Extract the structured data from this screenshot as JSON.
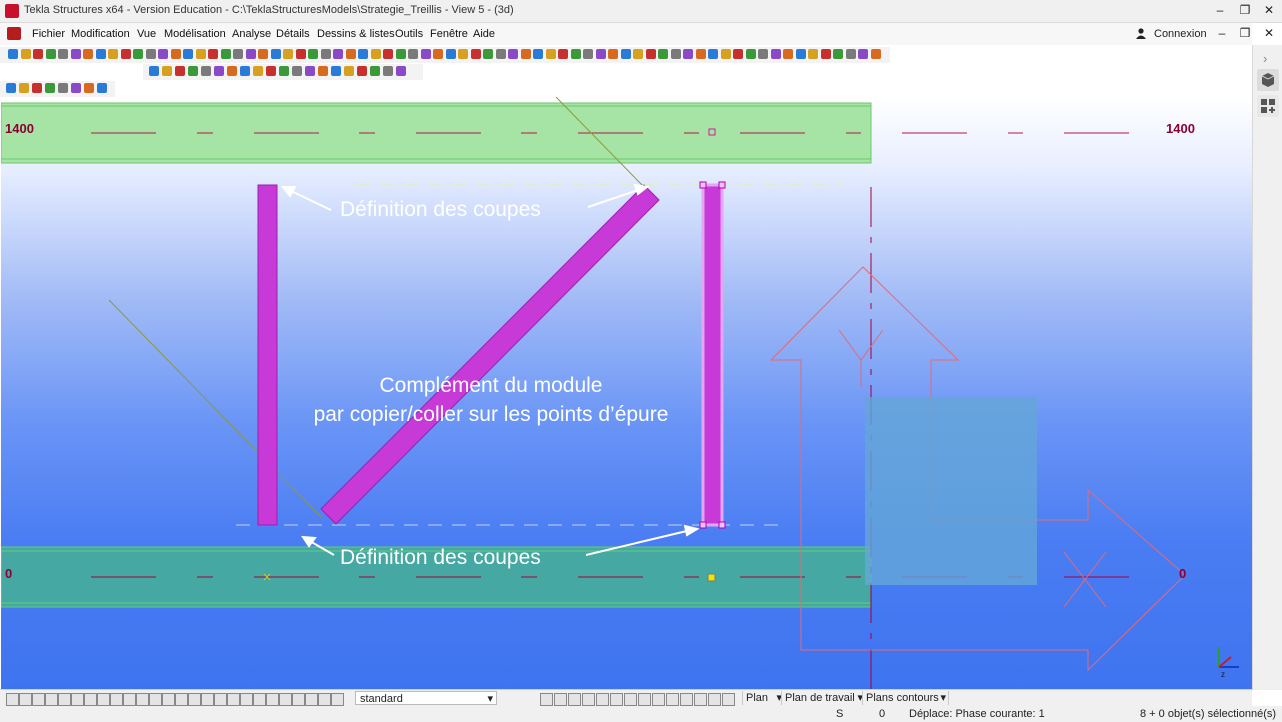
{
  "window": {
    "title": "Tekla Structures x64 - Version Education - C:\\TeklaStructuresModels\\Strategie_Treillis  - View 5 - (3d)",
    "controls": {
      "minimize": "–",
      "restore": "❐",
      "close": "✕"
    }
  },
  "menu": {
    "items": [
      "Fichier",
      "Modification",
      "Vue",
      "Modélisation",
      "Analyse",
      "Détails",
      "Dessins & listes",
      "Outils",
      "Fenêtre",
      "Aide"
    ],
    "connexion": "Connexion",
    "inner_controls": {
      "minimize": "–",
      "restore": "❐",
      "close": "✕"
    }
  },
  "viewport": {
    "grid_labels": {
      "top_left": "1400",
      "top_right": "1400",
      "bottom_left": "0",
      "bottom_right": "0"
    },
    "annotations": {
      "cuts_top": "Définition des coupes",
      "cuts_bottom": "Définition des coupes",
      "complement_line1": "Complément du module",
      "complement_line2": "par copier/coller sur les points d’épure"
    },
    "colors": {
      "beam_green": "#9ee29e",
      "beam_teal": "#41aaa0",
      "member_magenta": "#c83ad8",
      "grid_red": "#a8003c",
      "workplane_red": "#e06a7a"
    }
  },
  "statusbar": {
    "selection_filter": "standard",
    "dropdowns": [
      "Plan",
      "Plan de travail",
      "Plans contours"
    ]
  },
  "infobar": {
    "snap_mode": "S",
    "value": "0",
    "phase": "Déplace: Phase courante: 1",
    "selection": "8 + 0 objet(s) sélectionné(s)"
  }
}
